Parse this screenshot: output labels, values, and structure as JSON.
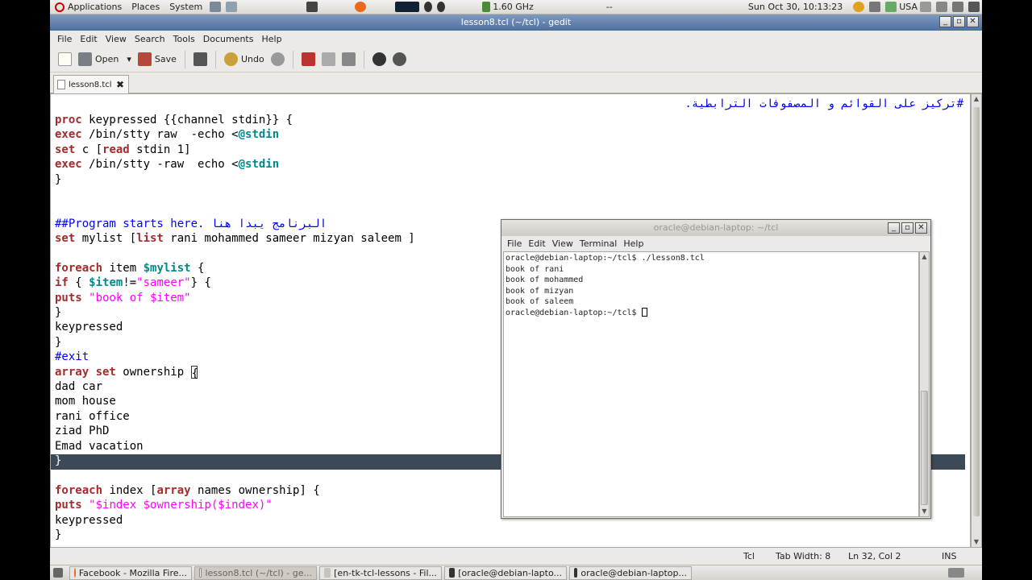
{
  "top_panel": {
    "menus": [
      "Applications",
      "Places",
      "System"
    ],
    "cpu_freq": "1.60 GHz",
    "dashes": "--",
    "clock": "Sun Oct 30, 10:13:23",
    "keyboard": "USA"
  },
  "gedit": {
    "title": "lesson8.tcl (~/tcl) - gedit",
    "menu": [
      "File",
      "Edit",
      "View",
      "Search",
      "Tools",
      "Documents",
      "Help"
    ],
    "toolbar": {
      "open": "Open",
      "save": "Save",
      "undo": "Undo"
    },
    "tab": {
      "label": "lesson8.tcl",
      "close": "✖"
    },
    "arabic_comment": "#تركيز على القوائم و  المصفوفات الترابطية.",
    "status": {
      "lang": "Tcl",
      "tab_width": "Tab Width: 8",
      "position": "Ln 32, Col 2",
      "mode": "INS"
    }
  },
  "code": {
    "l1a": "proc",
    "l1b": " keypressed {{channel stdin}} {",
    "l2a": "exec",
    "l2b": " /bin/stty raw  -echo <",
    "l2c": "@stdin",
    "l3a": "set",
    "l3b": " c [",
    "l3c": "read",
    "l3d": " stdin 1]",
    "l4a": "exec",
    "l4b": " /bin/stty -raw  echo <",
    "l4c": "@stdin",
    "l5": "}",
    "l8": "##Program starts here. البرنامج يبدا هنا",
    "l9a": "set",
    "l9b": " mylist [",
    "l9c": "list",
    "l9d": " rani mohammed sameer mizyan saleem ]",
    "l11a": "foreach",
    "l11b": " item ",
    "l11c": "$mylist",
    "l11d": " {",
    "l12a": "if",
    "l12b": " { ",
    "l12c": "$item",
    "l12d": "!=",
    "l12e": "\"sameer\"",
    "l12f": "} {",
    "l13a": "puts",
    "l13b": "\"book of $item\"",
    "l14": "}",
    "l15": "keypressed",
    "l16": "}",
    "l17": "#exit",
    "l18a": "array set",
    "l18b": " ownership ",
    "l18c": "{",
    "l19": "dad car",
    "l20": "mom house",
    "l21": "rani office",
    "l22": "ziad PhD",
    "l23": "Emad vacation",
    "l24": "}",
    "l26a": "foreach",
    "l26b": " index [",
    "l26c": "array",
    "l26d": " names ownership] {",
    "l27a": "puts",
    "l27b": "\"$index $ownership($index)\"",
    "l28": "keypressed",
    "l29": "}"
  },
  "terminal": {
    "title": "oracle@debian-laptop: ~/tcl",
    "menu": [
      "File",
      "Edit",
      "View",
      "Terminal",
      "Help"
    ],
    "lines": [
      "oracle@debian-laptop:~/tcl$ ./lesson8.tcl",
      "book of rani",
      "book of mohammed",
      "book of mizyan",
      "book of saleem",
      "oracle@debian-laptop:~/tcl$ "
    ]
  },
  "taskbar": [
    "Facebook - Mozilla Fire...",
    "lesson8.tcl (~/tcl) - ge...",
    "[en-tk-tcl-lessons - Fil...",
    "[oracle@debian-lapto...",
    "oracle@debian-laptop..."
  ],
  "colors": {
    "title_bar": "#4e6f9e",
    "keyword": "#a52a2a",
    "variable": "#008a8c",
    "string": "#ff00ff",
    "comment": "#0000ff"
  }
}
